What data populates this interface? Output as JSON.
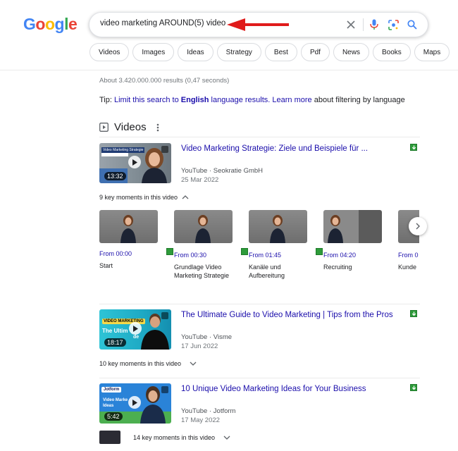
{
  "logo": {
    "letters": [
      "G",
      "o",
      "o",
      "g",
      "l",
      "e"
    ],
    "colors": [
      "#4285f4",
      "#ea4335",
      "#fbbc05",
      "#4285f4",
      "#34a853",
      "#ea4335"
    ]
  },
  "search": {
    "query": "video marketing AROUND(5) video"
  },
  "chips": [
    "Videos",
    "Images",
    "Ideas",
    "Strategy",
    "Best",
    "Pdf",
    "News",
    "Books",
    "Maps"
  ],
  "stats": "About 3.420.000.000 results (0,47 seconds)",
  "tip": {
    "prefix": "Tip: ",
    "link1": "Limit this search to ",
    "bold": "English",
    "link1_end": " language results.",
    "link2": "Learn more",
    "suffix": " about filtering by language"
  },
  "videos_heading": "Videos",
  "results": [
    {
      "title": "Video Marketing Strategie: Ziele und Beispiele für ...",
      "source": "YouTube",
      "channel": "Seokratie GmbH",
      "date": "25 Mar 2022",
      "duration": "13:32",
      "thumb_caption": "Video Marketing Strategie",
      "key_moments": "9 key moments in this video"
    },
    {
      "title": "The Ultimate Guide to Video Marketing | Tips from the Pros",
      "source": "YouTube",
      "channel": "Visme",
      "date": "17 Jun 2022",
      "duration": "18:17",
      "thumb_caption": "VIDEO MARKETING",
      "thumb_caption2": "The Ultim",
      "thumb_caption3": "de",
      "key_moments": "10 key moments in this video"
    },
    {
      "title": "10 Unique Video Marketing Ideas for Your Business",
      "source": "YouTube",
      "channel": "Jotform",
      "date": "17 May 2022",
      "duration": "5:42",
      "thumb_caption": "Jotform",
      "thumb_caption2": "Video Marke",
      "thumb_caption3": "Ideas",
      "key_moments": "14 key moments in this video"
    }
  ],
  "moments": [
    {
      "from": "From 00:00",
      "label": "Start"
    },
    {
      "from": "From 00:30",
      "label": "Grundlage Video Marketing Strategie"
    },
    {
      "from": "From 01:45",
      "label": "Kanäle und Aufbereitung"
    },
    {
      "from": "From 04:20",
      "label": "Recruiting"
    },
    {
      "from": "From 0",
      "label": "Kunde"
    }
  ],
  "separator": " · "
}
